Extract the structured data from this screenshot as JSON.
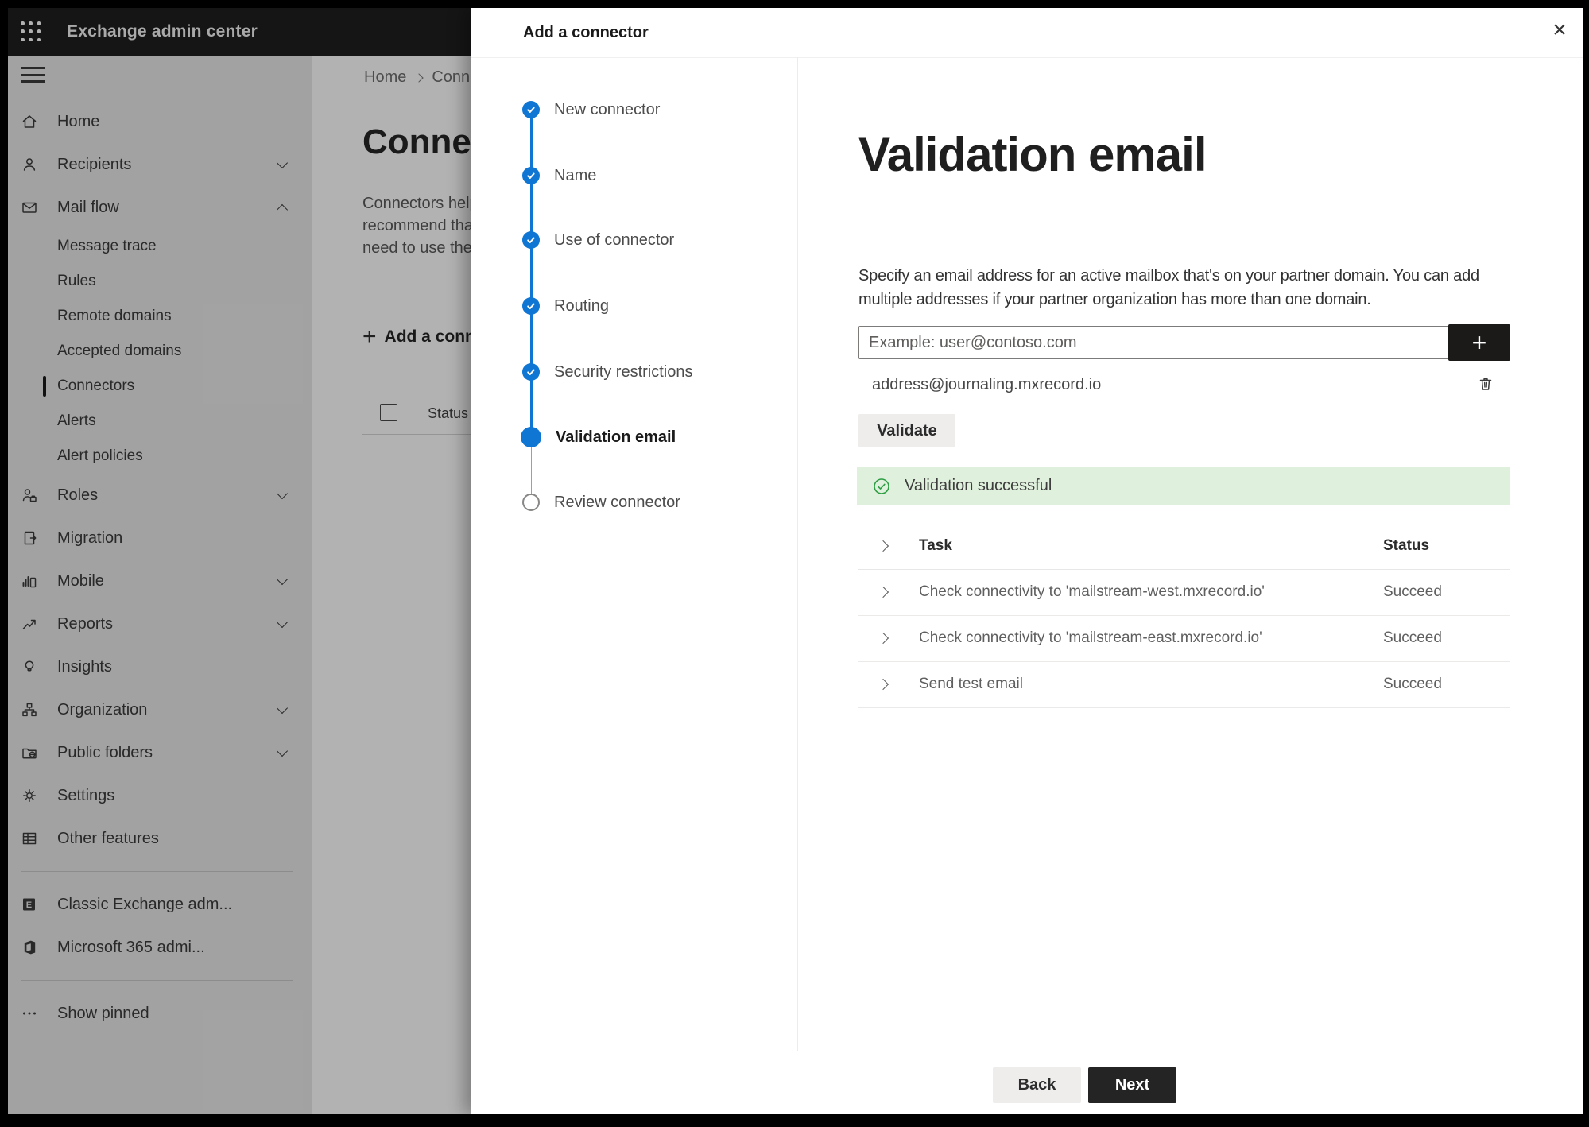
{
  "colors": {
    "accent_blue": "#0f76d3",
    "success_banner_bg": "#dff0dc",
    "success_green": "#2e9e44",
    "primary_button_bg": "#242424",
    "add_address_button_bg": "#1b1a19",
    "topbar_bg": "#1f1f1f"
  },
  "topbar": {
    "app_title": "Exchange admin center"
  },
  "sidebar": {
    "items": [
      {
        "label": "Home"
      },
      {
        "label": "Recipients"
      },
      {
        "label": "Mail flow"
      },
      {
        "label": "Message trace"
      },
      {
        "label": "Rules"
      },
      {
        "label": "Remote domains"
      },
      {
        "label": "Accepted domains"
      },
      {
        "label": "Connectors",
        "selected": true
      },
      {
        "label": "Alerts"
      },
      {
        "label": "Alert policies"
      },
      {
        "label": "Roles"
      },
      {
        "label": "Migration"
      },
      {
        "label": "Mobile"
      },
      {
        "label": "Reports"
      },
      {
        "label": "Insights"
      },
      {
        "label": "Organization"
      },
      {
        "label": "Public folders"
      },
      {
        "label": "Settings"
      },
      {
        "label": "Other features"
      },
      {
        "label": "Classic Exchange adm..."
      },
      {
        "label": "Microsoft 365 admi..."
      },
      {
        "label": "Show pinned"
      }
    ]
  },
  "page": {
    "breadcrumb": {
      "home": "Home",
      "current": "Connectors"
    },
    "title": "Connectors",
    "intro_lines": [
      "Connectors help",
      "recommend that",
      "need to use them"
    ],
    "add_button": "Add a conn",
    "status_header": "Status"
  },
  "panel": {
    "title": "Add a connector",
    "steps": [
      {
        "label": "New connector",
        "state": "complete"
      },
      {
        "label": "Name",
        "state": "complete"
      },
      {
        "label": "Use of connector",
        "state": "complete"
      },
      {
        "label": "Routing",
        "state": "complete"
      },
      {
        "label": "Security restrictions",
        "state": "complete"
      },
      {
        "label": "Validation email",
        "state": "current"
      },
      {
        "label": "Review connector",
        "state": "upcoming"
      }
    ],
    "content": {
      "heading": "Validation email",
      "description_lines": [
        "Specify an email address for an active mailbox that's on your partner domain. You can add",
        "multiple addresses if your partner organization has more than one domain."
      ],
      "email_placeholder": "Example: user@contoso.com",
      "added_address": "address@journaling.mxrecord.io",
      "validate_button": "Validate",
      "success_message": "Validation successful",
      "table": {
        "headers": [
          "Task",
          "Status"
        ],
        "rows": [
          {
            "task": "Check connectivity to 'mailstream-west.mxrecord.io'",
            "status": "Succeed"
          },
          {
            "task": "Check connectivity to 'mailstream-east.mxrecord.io'",
            "status": "Succeed"
          },
          {
            "task": "Send test email",
            "status": "Succeed"
          }
        ]
      }
    },
    "footer": {
      "back": "Back",
      "next": "Next"
    }
  }
}
